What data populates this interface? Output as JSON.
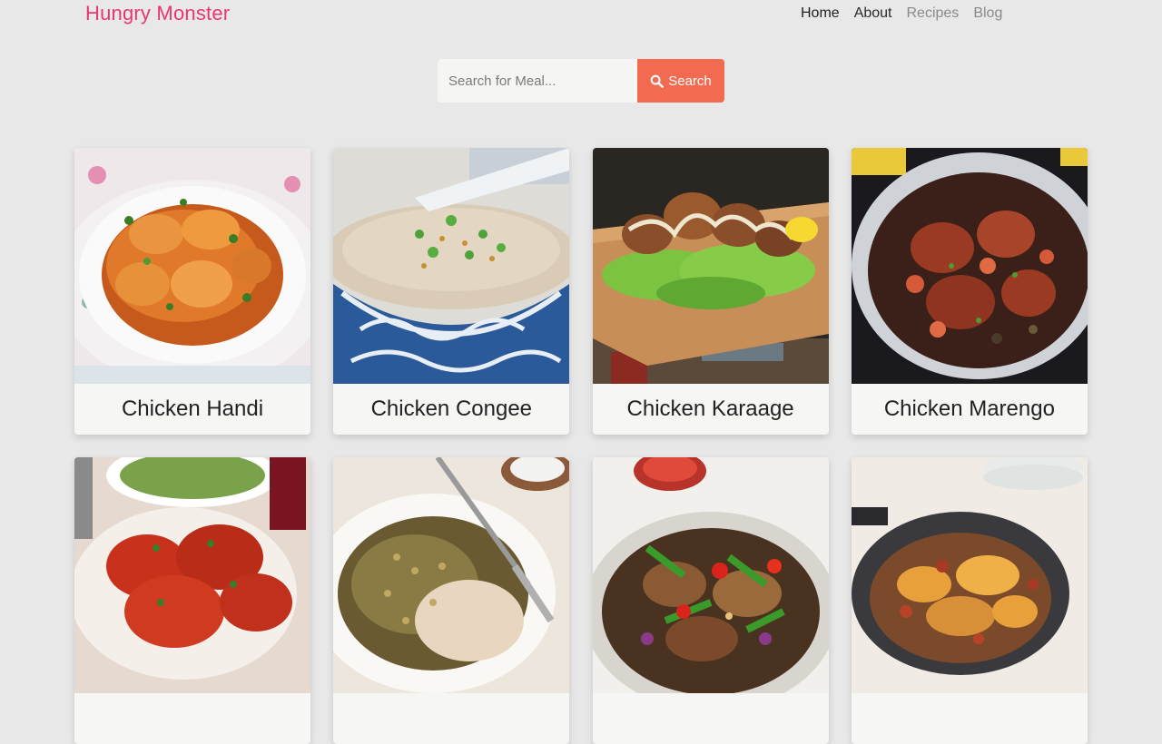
{
  "navbar": {
    "brand": "Hungry Monster",
    "links": [
      {
        "label": "Home",
        "active": true
      },
      {
        "label": "About",
        "active": false
      },
      {
        "label": "Recipes",
        "active": false
      },
      {
        "label": "Blog",
        "active": false
      }
    ]
  },
  "search": {
    "placeholder": "Search for Meal...",
    "value": "",
    "button_label": "Search",
    "button_icon": "search-icon",
    "button_color": "#f26a50"
  },
  "colors": {
    "brand": "#e8386e",
    "background": "#e8e8e8",
    "card": "#f6f6f4"
  },
  "meals": [
    {
      "name": "Chicken Handi"
    },
    {
      "name": "Chicken Congee"
    },
    {
      "name": "Chicken Karaage"
    },
    {
      "name": "Chicken Marengo"
    },
    {
      "name": ""
    },
    {
      "name": ""
    },
    {
      "name": ""
    },
    {
      "name": ""
    }
  ]
}
